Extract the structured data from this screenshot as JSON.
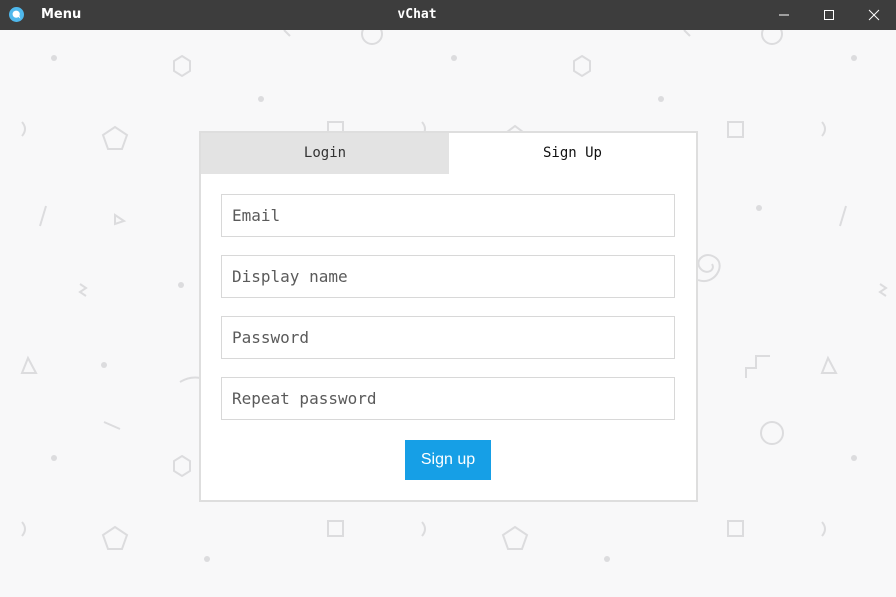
{
  "titlebar": {
    "app_icon": "chat-bubble-icon",
    "menu_label": "Menu",
    "title": "vChat",
    "minimize_icon": "minimize-icon",
    "maximize_icon": "maximize-icon",
    "close_icon": "close-icon"
  },
  "tabs": [
    {
      "label": "Login",
      "active": false
    },
    {
      "label": "Sign Up",
      "active": true
    }
  ],
  "form": {
    "email_placeholder": "Email",
    "display_name_placeholder": "Display name",
    "password_placeholder": "Password",
    "repeat_password_placeholder": "Repeat password",
    "submit_label": "Sign up"
  },
  "colors": {
    "titlebar": "#3d3d3d",
    "accent": "#169fe6",
    "background": "#f8f8f9",
    "inactive_tab": "#e3e3e3",
    "pattern": "#dcdcde"
  }
}
